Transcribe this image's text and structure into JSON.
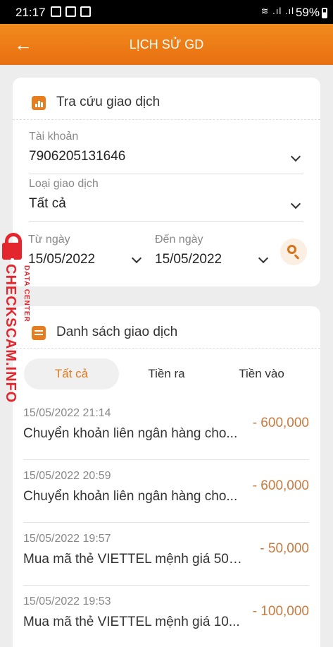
{
  "status_bar": {
    "time": "21:17",
    "battery": "59%",
    "signal": "≋ .ıl .ıl"
  },
  "header": {
    "title": "LỊCH SỬ GD"
  },
  "search_card": {
    "title": "Tra cứu giao dịch",
    "account_label": "Tài khoản",
    "account_value": "7906205131646",
    "type_label": "Loại giao dịch",
    "type_value": "Tất cả",
    "from_label": "Từ ngày",
    "from_value": "15/05/2022",
    "to_label": "Đến ngày",
    "to_value": "15/05/2022"
  },
  "list_card": {
    "title": "Danh sách giao dịch",
    "tabs": [
      "Tất cả",
      "Tiền ra",
      "Tiền vào"
    ],
    "transactions": [
      {
        "date": "15/05/2022 21:14",
        "desc": "Chuyển khoản liên ngân hàng cho...",
        "amount": "- 600,000"
      },
      {
        "date": "15/05/2022 20:59",
        "desc": "Chuyển khoản liên ngân hàng cho...",
        "amount": "- 600,000"
      },
      {
        "date": "15/05/2022 19:57",
        "desc": "Mua mã thẻ VIETTEL mệnh giá 500...",
        "amount": "- 50,000"
      },
      {
        "date": "15/05/2022 19:53",
        "desc": "Mua mã thẻ VIETTEL mệnh giá 10...",
        "amount": "- 100,000"
      }
    ]
  },
  "watermark": {
    "main": "CHECKSCAM.INFO",
    "sub": "DATA CENTER"
  },
  "colors": {
    "accent": "#e86f10",
    "amount": "#c97a3f",
    "watermark": "#e3262e"
  }
}
